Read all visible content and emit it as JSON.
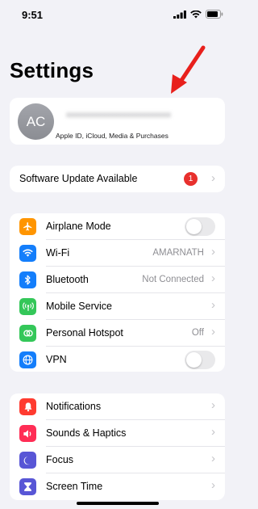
{
  "status_bar": {
    "time": "9:51"
  },
  "page_title": "Settings",
  "profile": {
    "initials": "AC",
    "name_blurred": "xxxxxxxxxxxxxxxxxxxxxxxxxx",
    "subtitle": "Apple ID, iCloud, Media & Purchases"
  },
  "software_update": {
    "label": "Software Update Available",
    "badge": "1"
  },
  "connectivity": [
    {
      "label": "Airplane Mode",
      "icon": "airplane-icon",
      "color": "#ff9500",
      "type": "toggle",
      "on": false
    },
    {
      "label": "Wi-Fi",
      "icon": "wifi-icon",
      "color": "#147efb",
      "type": "value",
      "value": "AMARNATH"
    },
    {
      "label": "Bluetooth",
      "icon": "bluetooth-icon",
      "color": "#147efb",
      "type": "value",
      "value": "Not Connected"
    },
    {
      "label": "Mobile Service",
      "icon": "antenna-icon",
      "color": "#34c759",
      "type": "chevron"
    },
    {
      "label": "Personal Hotspot",
      "icon": "hotspot-icon",
      "color": "#34c759",
      "type": "value",
      "value": "Off"
    },
    {
      "label": "VPN",
      "icon": "globe-icon",
      "color": "#147efb",
      "type": "toggle",
      "on": false
    }
  ],
  "notifications_group": [
    {
      "label": "Notifications",
      "icon": "bell-icon",
      "color": "#ff3b30",
      "type": "chevron"
    },
    {
      "label": "Sounds & Haptics",
      "icon": "speaker-icon",
      "color": "#ff2d55",
      "type": "chevron"
    },
    {
      "label": "Focus",
      "icon": "moon-icon",
      "color": "#5856d6",
      "type": "chevron"
    },
    {
      "label": "Screen Time",
      "icon": "hourglass-icon",
      "color": "#5856d6",
      "type": "chevron"
    }
  ],
  "annotation_arrow_color": "#e8201c"
}
